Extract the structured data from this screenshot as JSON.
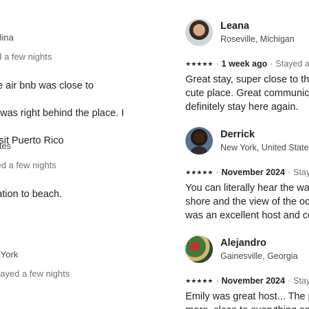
{
  "left_reviews": [
    {
      "location": "rolina",
      "meta": "ed a few nights",
      "body_lines": [
        "he air bnb was close to",
        "h was right behind the place. I",
        "visit Puerto Rico"
      ]
    },
    {
      "location": "tates",
      "meta": "yed a few nights",
      "body_lines": [
        "cation to beach."
      ]
    },
    {
      "location": "w York",
      "meta": "Stayed a few nights",
      "body_lines": []
    }
  ],
  "right_reviews": [
    {
      "avatar_icon": "user-avatar-photo",
      "name": "Leana",
      "location": "Roseville, Michigan",
      "stars": "★★★★★",
      "date": "1 week ago",
      "stay": "Stayed a fe",
      "body_lines": [
        "Great stay, super close to the o",
        "cute place. Great communicati",
        "definitely stay here again."
      ]
    },
    {
      "avatar_icon": "user-avatar-photo",
      "name": "Derrick",
      "location": "New York, United States",
      "stars": "★★★★★",
      "date": "November 2024",
      "stay": "Staye",
      "body_lines": [
        "You can literally hear the wave",
        "shore and the view of the ocea",
        "was an excellent host and com"
      ]
    },
    {
      "avatar_icon": "user-avatar-photo",
      "name": "Alejandro",
      "location": "Gainesville, Georgia",
      "stars": "★★★★★",
      "date": "November 2024",
      "stay": "Staye",
      "body_lines": [
        "Emily was great host... The pla",
        "more, close to everything and"
      ]
    }
  ],
  "separator": "·"
}
